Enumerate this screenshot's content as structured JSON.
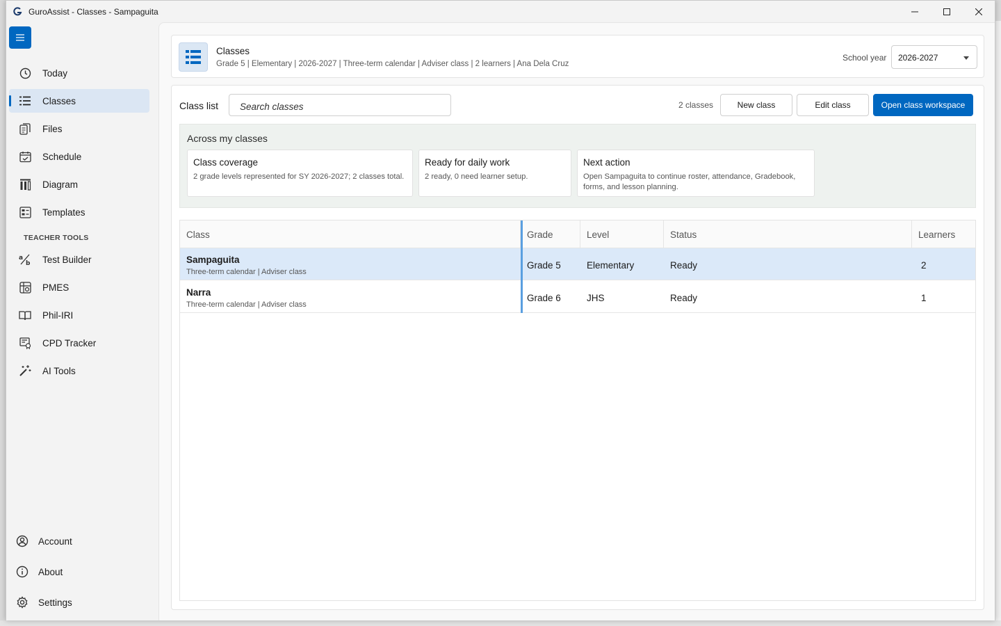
{
  "window": {
    "title": "GuroAssist - Classes - Sampaguita"
  },
  "sidebar": {
    "items": [
      {
        "label": "Today",
        "icon": "clock-icon"
      },
      {
        "label": "Classes",
        "icon": "list-icon",
        "active": true
      },
      {
        "label": "Files",
        "icon": "files-icon"
      },
      {
        "label": "Schedule",
        "icon": "calendar-icon"
      },
      {
        "label": "Diagram",
        "icon": "diagram-icon"
      },
      {
        "label": "Templates",
        "icon": "templates-icon"
      }
    ],
    "section_title": "TEACHER TOOLS",
    "tools": [
      {
        "label": "Test Builder",
        "icon": "test-builder-icon"
      },
      {
        "label": "PMES",
        "icon": "pmes-icon"
      },
      {
        "label": "Phil-IRI",
        "icon": "book-icon"
      },
      {
        "label": "CPD Tracker",
        "icon": "cpd-icon"
      },
      {
        "label": "AI Tools",
        "icon": "magic-wand-icon"
      }
    ],
    "bottom": [
      {
        "label": "Account",
        "icon": "account-icon"
      },
      {
        "label": "About",
        "icon": "info-icon"
      },
      {
        "label": "Settings",
        "icon": "gear-icon"
      }
    ]
  },
  "header": {
    "title": "Classes",
    "subtitle": "Grade 5 | Elementary | 2026-2027 | Three-term calendar | Adviser class | 2 learners | Ana Dela Cruz",
    "school_year_label": "School year",
    "school_year_value": "2026-2027"
  },
  "toolbar": {
    "label": "Class list",
    "search_placeholder": "Search classes",
    "count": "2 classes",
    "new_label": "New class",
    "edit_label": "Edit class",
    "open_label": "Open class workspace"
  },
  "across": {
    "title": "Across my classes",
    "cards": [
      {
        "title": "Class coverage",
        "text": "2 grade levels represented for SY 2026-2027; 2 classes total."
      },
      {
        "title": "Ready for daily work",
        "text": "2 ready, 0 need learner setup."
      },
      {
        "title": "Next action",
        "text": "Open Sampaguita to continue roster, attendance, Gradebook, forms, and lesson planning."
      }
    ]
  },
  "table": {
    "columns": [
      "Class",
      "Grade",
      "Level",
      "Status",
      "Learners"
    ],
    "rows": [
      {
        "name": "Sampaguita",
        "sub": "Three-term calendar | Adviser class",
        "grade": "Grade 5",
        "level": "Elementary",
        "status": "Ready",
        "learners": "2",
        "selected": true
      },
      {
        "name": "Narra",
        "sub": "Three-term calendar | Adviser class",
        "grade": "Grade 6",
        "level": "JHS",
        "status": "Ready",
        "learners": "1",
        "selected": false
      }
    ]
  },
  "colors": {
    "accent": "#0067c0",
    "selected_row": "#dbe9f9",
    "active_nav": "#dbe6f3"
  }
}
